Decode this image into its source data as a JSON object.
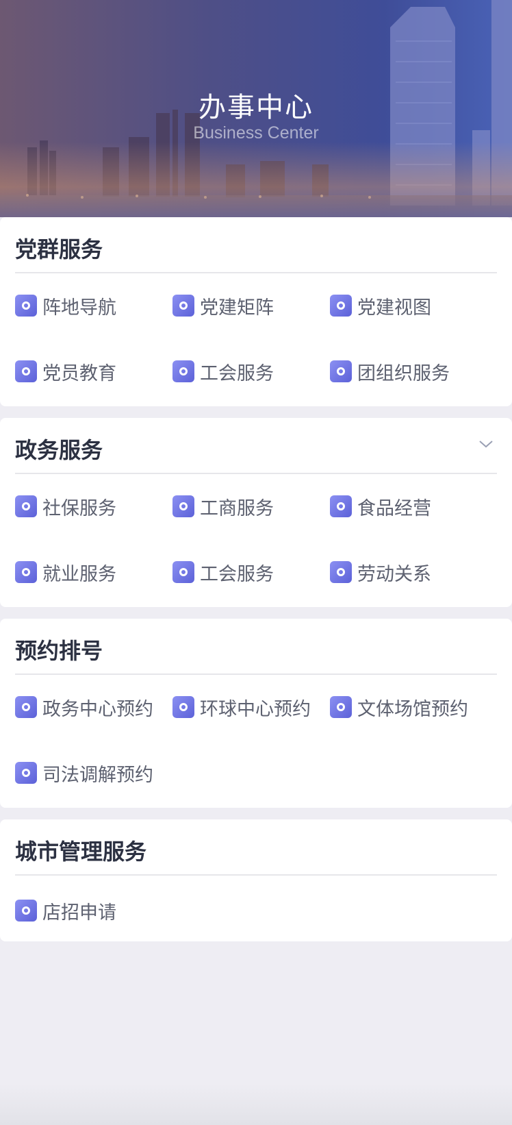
{
  "hero": {
    "title": "办事中心",
    "subtitle": "Business Center"
  },
  "sections": [
    {
      "title": "党群服务",
      "collapsible": false,
      "items": [
        "阵地导航",
        "党建矩阵",
        "党建视图",
        "党员教育",
        "工会服务",
        "团组织服务"
      ]
    },
    {
      "title": "政务服务",
      "collapsible": true,
      "items": [
        "社保服务",
        "工商服务",
        "食品经营",
        "就业服务",
        "工会服务",
        "劳动关系"
      ]
    },
    {
      "title": "预约排号",
      "collapsible": false,
      "items": [
        "政务中心预约",
        "环球中心预约",
        "文体场馆预约",
        "司法调解预约"
      ]
    },
    {
      "title": "城市管理服务",
      "collapsible": false,
      "items": [
        "店招申请"
      ]
    }
  ],
  "colors": {
    "accent": "#6b70e0",
    "title": "#2c3142",
    "label": "#5d6170",
    "background": "#eeedf3"
  },
  "icons": {
    "item": "service-badge-icon",
    "expand": "chevron-down-icon"
  }
}
